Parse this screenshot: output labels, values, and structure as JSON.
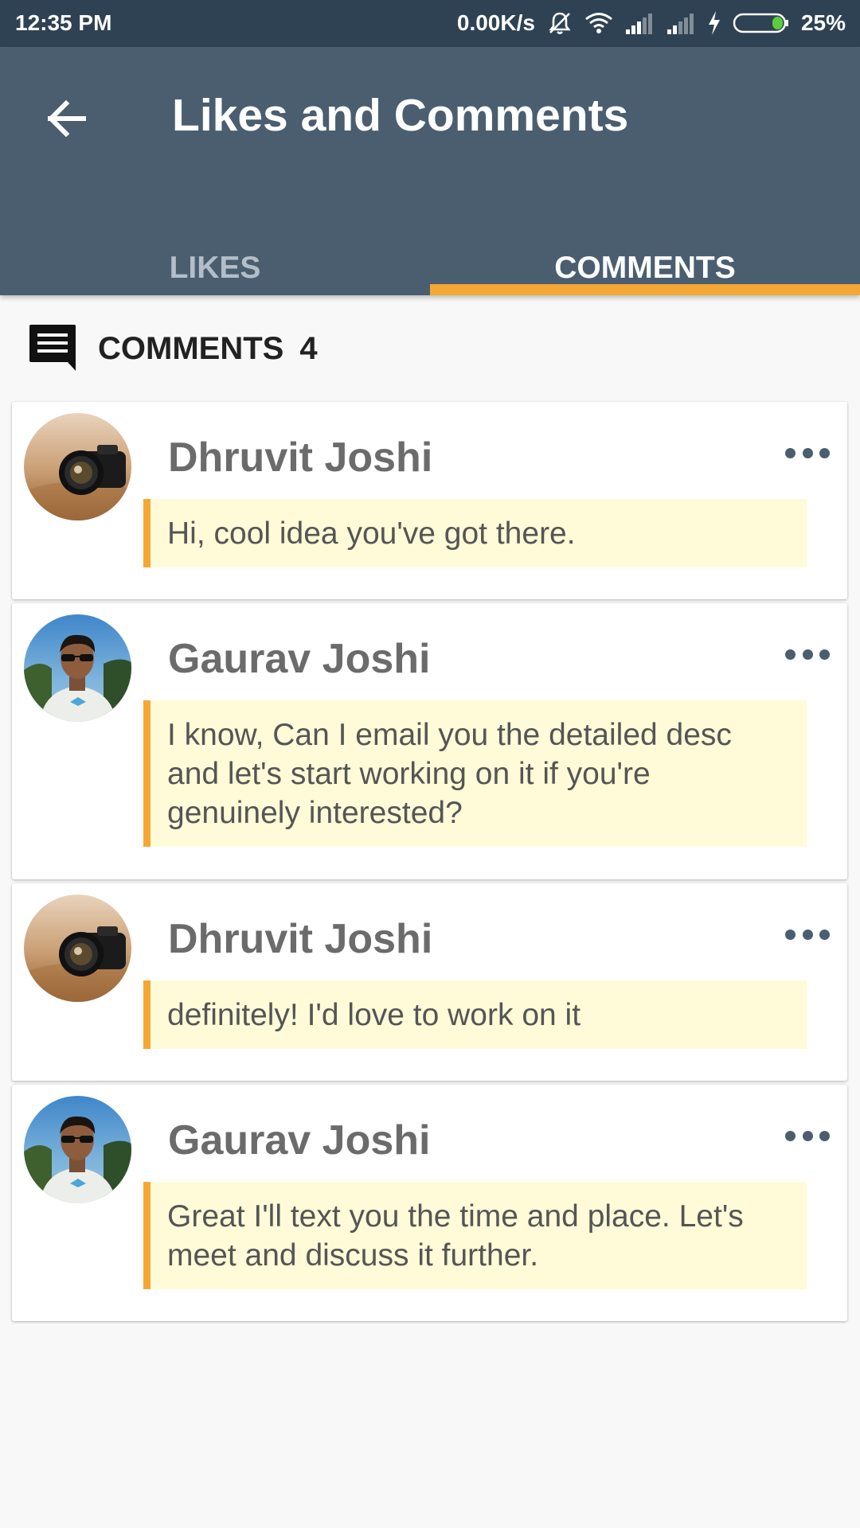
{
  "status_bar": {
    "time": "12:35 PM",
    "network_speed": "0.00K/s",
    "battery": "25%",
    "icons": [
      "mute-icon",
      "wifi-icon",
      "signal-icon",
      "signal-icon",
      "charging-icon",
      "battery-icon"
    ]
  },
  "app_bar": {
    "title": "Likes and Comments",
    "back_icon": "arrow-left-icon"
  },
  "tabs": [
    {
      "label": "LIKES",
      "selected": false
    },
    {
      "label": "COMMENTS",
      "selected": true
    }
  ],
  "comments_section": {
    "icon": "comment-icon",
    "label": "COMMENTS",
    "count": "4"
  },
  "comments": [
    {
      "author": "Dhruvit Joshi",
      "text": "Hi, cool idea you've got there.",
      "avatar": "camera-avatar"
    },
    {
      "author": "Gaurav Joshi",
      "text": "I know, Can I email you the detailed desc and let's start working on it if you're genuinely interested?",
      "avatar": "person-avatar"
    },
    {
      "author": "Dhruvit Joshi",
      "text": "definitely! I'd love to work on it",
      "avatar": "camera-avatar"
    },
    {
      "author": "Gaurav Joshi",
      "text": "Great I'll text you the time and place. Let's meet and discuss it further.",
      "avatar": "person-avatar"
    }
  ],
  "colors": {
    "status_bar": "#2f4254",
    "app_bar": "#4a5e70",
    "accent": "#f5a735",
    "bubble": "#fffbd8",
    "background": "#f8f8f8"
  }
}
